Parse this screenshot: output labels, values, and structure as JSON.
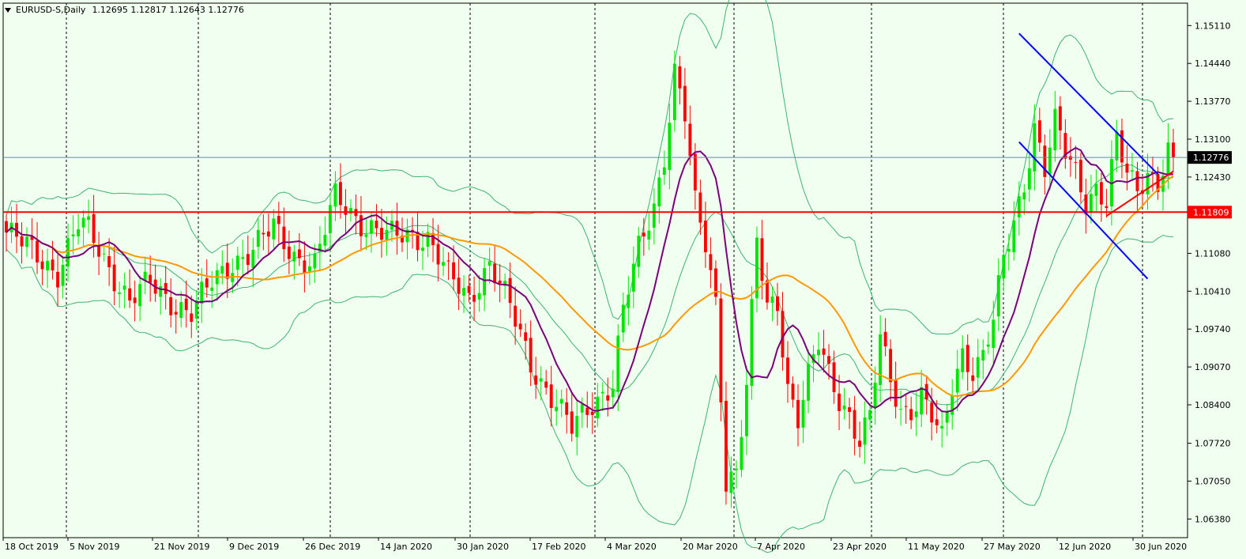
{
  "header": {
    "symbol": "EURUSD-S,Daily",
    "ohlc": "1.12695 1.12817 1.12643 1.12776"
  },
  "chart_data": {
    "type": "candlestick",
    "symbol": "EURUSD-S",
    "timeframe": "Daily",
    "open": 1.12695,
    "high": 1.12817,
    "low": 1.12643,
    "close": 1.12776,
    "ylim": [
      1.0605,
      1.1545
    ],
    "y_ticks": [
      1.1511,
      1.1444,
      1.1377,
      1.131,
      1.1243,
      1.1176,
      1.1108,
      1.1041,
      1.0974,
      1.0907,
      1.084,
      1.0772,
      1.0705,
      1.0638
    ],
    "y_tick_labels": [
      "1.15110",
      "1.14440",
      "1.13770",
      "1.13100",
      "1.12430",
      "1.11760",
      "1.11080",
      "1.10410",
      "1.09740",
      "1.09070",
      "1.08400",
      "1.07720",
      "1.07050",
      "1.06380"
    ],
    "x_labels": [
      "18 Oct 2019",
      "5 Nov 2019",
      "21 Nov 2019",
      "9 Dec 2019",
      "26 Dec 2019",
      "14 Jan 2020",
      "30 Jan 2020",
      "17 Feb 2020",
      "4 Mar 2020",
      "20 Mar 2020",
      "7 Apr 2020",
      "23 Apr 2020",
      "11 May 2020",
      "27 May 2020",
      "12 Jun 2020",
      "30 Jun 2020"
    ],
    "current_price_label": "1.12776",
    "horizontal_level": 1.11809,
    "horizontal_level_label": "1.11809",
    "price_line": 1.12776,
    "period_separator_count": 9,
    "close_anchors": [
      [
        0,
        1.1145
      ],
      [
        6,
        1.1105
      ],
      [
        10,
        1.1075
      ],
      [
        14,
        1.1157
      ],
      [
        16,
        1.1148
      ],
      [
        20,
        1.1085
      ],
      [
        24,
        1.1022
      ],
      [
        28,
        1.1055
      ],
      [
        32,
        1.1025
      ],
      [
        36,
        1.1002
      ],
      [
        40,
        1.1055
      ],
      [
        44,
        1.1095
      ],
      [
        48,
        1.1112
      ],
      [
        52,
        1.1154
      ],
      [
        56,
        1.1108
      ],
      [
        60,
        1.1085
      ],
      [
        64,
        1.1208
      ],
      [
        66,
        1.1195
      ],
      [
        70,
        1.1155
      ],
      [
        74,
        1.1135
      ],
      [
        78,
        1.1145
      ],
      [
        82,
        1.1135
      ],
      [
        86,
        1.1065
      ],
      [
        90,
        1.103
      ],
      [
        94,
        1.1092
      ],
      [
        98,
        1.101
      ],
      [
        102,
        1.0915
      ],
      [
        106,
        1.0855
      ],
      [
        110,
        1.0795
      ],
      [
        114,
        1.0845
      ],
      [
        118,
        1.088
      ],
      [
        120,
        1.1005
      ],
      [
        123,
        1.1113
      ],
      [
        126,
        1.1195
      ],
      [
        128,
        1.1285
      ],
      [
        130,
        1.143
      ],
      [
        132,
        1.135
      ],
      [
        134,
        1.119
      ],
      [
        136,
        1.1125
      ],
      [
        138,
        1.1025
      ],
      [
        140,
        1.071
      ],
      [
        142,
        1.072
      ],
      [
        144,
        1.087
      ],
      [
        146,
        1.1125
      ],
      [
        148,
        1.1015
      ],
      [
        150,
        1.1025
      ],
      [
        152,
        1.0875
      ],
      [
        154,
        1.0815
      ],
      [
        156,
        1.0885
      ],
      [
        158,
        1.0945
      ],
      [
        160,
        1.0895
      ],
      [
        162,
        1.0855
      ],
      [
        164,
        1.0825
      ],
      [
        166,
        1.0775
      ],
      [
        168,
        1.0815
      ],
      [
        170,
        1.0955
      ],
      [
        172,
        1.0885
      ],
      [
        174,
        1.0835
      ],
      [
        176,
        1.0835
      ],
      [
        178,
        1.0855
      ],
      [
        180,
        1.0815
      ],
      [
        182,
        1.0775
      ],
      [
        184,
        1.0875
      ],
      [
        186,
        1.0935
      ],
      [
        188,
        1.0905
      ],
      [
        190,
        1.0925
      ],
      [
        192,
        1.0985
      ],
      [
        194,
        1.1095
      ],
      [
        196,
        1.1165
      ],
      [
        198,
        1.1235
      ],
      [
        200,
        1.1335
      ],
      [
        202,
        1.1255
      ],
      [
        204,
        1.1335
      ],
      [
        206,
        1.1285
      ],
      [
        208,
        1.1255
      ],
      [
        210,
        1.1205
      ],
      [
        212,
        1.1225
      ],
      [
        214,
        1.1195
      ],
      [
        216,
        1.1305
      ],
      [
        218,
        1.1245
      ],
      [
        220,
        1.1225
      ],
      [
        222,
        1.1255
      ],
      [
        224,
        1.1235
      ],
      [
        226,
        1.1285
      ],
      [
        227,
        1.1278
      ]
    ],
    "overlays": {
      "sma_fast_color": "#7a007a",
      "sma_slow_color": "#ff9900",
      "bollinger_color": "#3cb371",
      "bull_color": "#00e600",
      "bear_color": "#ff0000"
    },
    "trendlines": {
      "channel_color": "#0000ff",
      "support_color": "#ff0000"
    },
    "grid": false
  }
}
